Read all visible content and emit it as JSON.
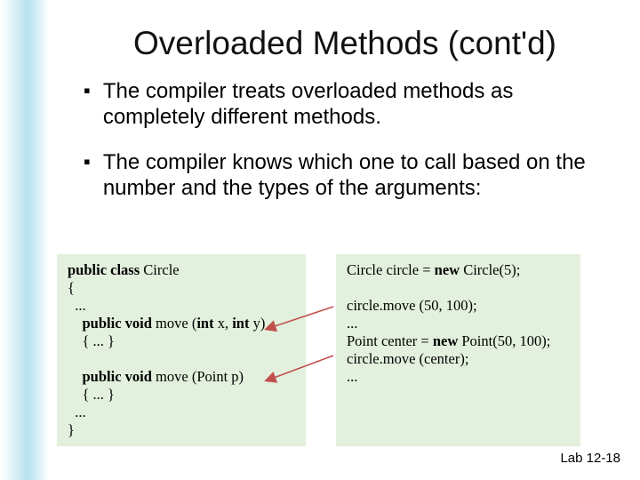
{
  "title": "Overloaded Methods (cont'd)",
  "bullets": [
    "The compiler treats overloaded methods as completely different methods.",
    "The compiler knows which one to call based on the number and the types of the arguments:"
  ],
  "code_left": {
    "l1a": "public class",
    "l1b": " Circle",
    "l2": "{",
    "l3": "  ...",
    "l4a": "    public void",
    "l4b": " move (",
    "l4c": "int",
    "l4d": " x, ",
    "l4e": "int",
    "l4f": " y)",
    "l5": "    { ... }",
    "l6": "",
    "l7a": "    public void",
    "l7b": " move (Point p)",
    "l8": "    { ... }",
    "l9": "  ...",
    "l10": "}"
  },
  "code_right": {
    "r1a": "Circle circle =  ",
    "r1b": "new",
    "r1c": " Circle(5);",
    "r2": "",
    "r3": "circle.move (50, 100);",
    "r4": "...",
    "r5a": "Point center = ",
    "r5b": "new",
    "r5c": " Point(50, 100);",
    "r6": "circle.move (center);",
    "r7": "..."
  },
  "footer": "Lab 12-18"
}
